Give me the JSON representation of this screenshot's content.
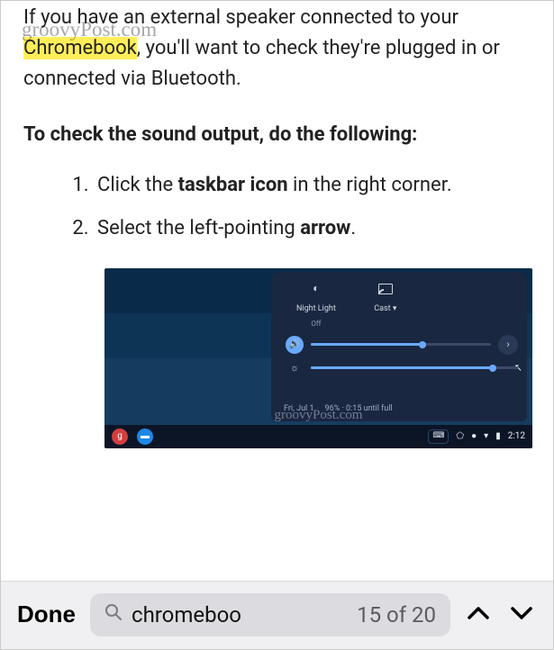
{
  "watermark": "groovyPost.com",
  "article": {
    "p1_a": "If you have an external speaker connected to your ",
    "p1_hl": "Chromebook",
    "p1_b": ", you'll want to check they're plugged in or connected via Bluetooth.",
    "heading": "To check the sound output, do the following:",
    "steps": [
      {
        "pre": "Click the ",
        "bold": "taskbar icon",
        "post": " in the right corner."
      },
      {
        "pre": "Select the left-pointing ",
        "bold": "arrow",
        "post": "."
      }
    ]
  },
  "shot": {
    "nightlight_label": "Night Light",
    "nightlight_state": "Off",
    "cast_label": "Cast ▾",
    "audio_fill_pct": 62,
    "bright_fill_pct": 88,
    "date": "Fri, Jul 1",
    "battery": "96% · 0:15 until full",
    "shelf_kbd": "⌨",
    "shelf_time": "2:12",
    "overlay_wm": "groovyPost.com"
  },
  "findbar": {
    "done": "Done",
    "query": "chromeboo",
    "count": "15 of 20"
  }
}
